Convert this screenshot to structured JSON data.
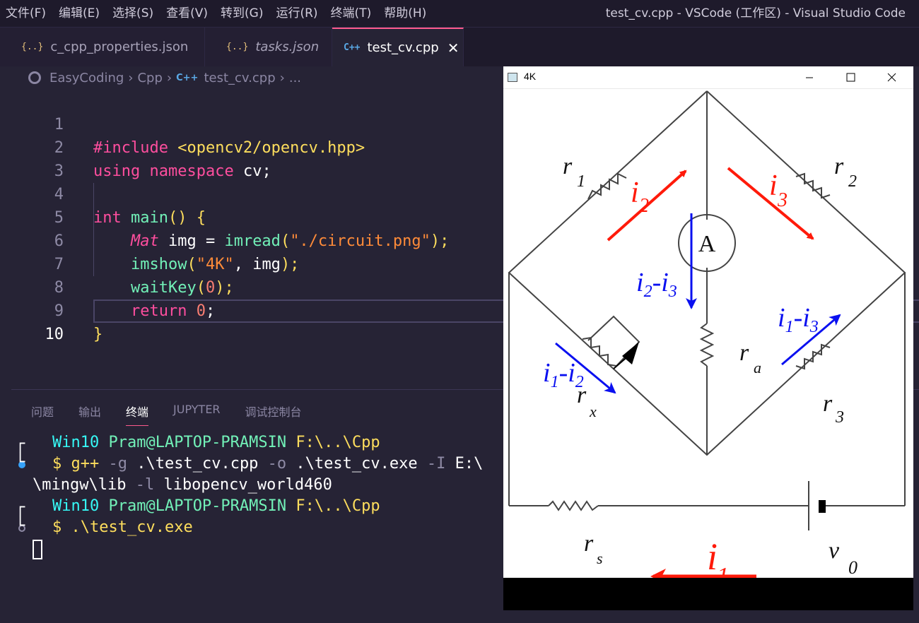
{
  "menu": [
    "文件(F)",
    "编辑(E)",
    "选择(S)",
    "查看(V)",
    "转到(G)",
    "运行(R)",
    "终端(T)",
    "帮助(H)"
  ],
  "window_title": "test_cv.cpp - VSCode (工作区) - Visual Studio Code",
  "tabs": [
    {
      "icon": "{..}",
      "label": "c_cpp_properties.json"
    },
    {
      "icon": "{..}",
      "label": "tasks.json"
    },
    {
      "icon": "C++",
      "label": "test_cv.cpp",
      "close": "✕"
    }
  ],
  "breadcrumb": [
    "EasyCoding",
    "Cpp",
    "test_cv.cpp",
    "..."
  ],
  "breadcrumb_file_icon": "C++",
  "breadcrumb_sep": "›",
  "line_numbers": [
    "1",
    "2",
    "3",
    "4",
    "5",
    "6",
    "7",
    "8",
    "9",
    "10"
  ],
  "code": {
    "l1_include": "#include",
    "l1_header": "<opencv2/opencv.hpp>",
    "l2_using": "using",
    "l2_namespace": "namespace",
    "l2_cv": " cv;",
    "l4_int": "int",
    "l4_main": "main",
    "l4_rest": "() {",
    "l5_mat": "Mat",
    "l5_img": " img = ",
    "l5_imread": "imread",
    "l5_open": "(",
    "l5_str": "\"./circuit.png\"",
    "l5_close": ");",
    "l6_imshow": "imshow",
    "l6_open": "(",
    "l6_str": "\"4K\"",
    "l6_rest": ", img",
    "l6_close": ");",
    "l7_waitkey": "waitKey",
    "l7_open": "(",
    "l7_num": "0",
    "l7_close": ");",
    "l8_return": "return",
    "l8_num": " 0",
    "l8_semi": ";",
    "l9_brace": "}"
  },
  "panel_tabs": [
    "问题",
    "输出",
    "终端",
    "JUPYTER",
    "调试控制台"
  ],
  "terminal": {
    "prompt1_os": "Win10",
    "prompt1_user": "Pram@LAPTOP-PRAMSIN",
    "prompt1_path": "F:\\..\\Cpp",
    "cmd1_dollar": "$ ",
    "cmd1_prog": "g++",
    "cmd1_g": " -g",
    "cmd1_src": " .\\test_cv.cpp",
    "cmd1_o": " -o",
    "cmd1_exe": " .\\test_cv.exe",
    "cmd1_I": " -I",
    "cmd1_e": " E:\\",
    "cmd1_cont": "\\mingw\\lib",
    "cmd1_l": " -l",
    "cmd1_lib": " libopencv_world460",
    "prompt2_os": "Win10",
    "prompt2_user": "Pram@LAPTOP-PRAMSIN",
    "prompt2_path": "F:\\..\\Cpp",
    "cmd2_dollar": "$ ",
    "cmd2_run": ".\\test_cv.exe",
    "bracket_top": "┌",
    "bracket_bot": "└"
  },
  "image_window": {
    "title": "4K",
    "labels": {
      "r1": "r",
      "r1_sub": "1",
      "r2": "r",
      "r2_sub": "2",
      "r3": "r",
      "r3_sub": "3",
      "ra": "r",
      "ra_sub": "a",
      "rx": "r",
      "rx_sub": "x",
      "rs": "r",
      "rs_sub": "s",
      "v0": "v",
      "v0_sub": "0",
      "ammeter": "A",
      "i1": "i",
      "i1_sub": "1",
      "i2": "i",
      "i2_sub": "2",
      "i3": "i",
      "i3_sub": "3",
      "i2_i3_a": "i",
      "i2_i3_a_sub": "2",
      "i2_i3_dash": "-i",
      "i2_i3_b_sub": "3",
      "i1_i3_a": "i",
      "i1_i3_a_sub": "1",
      "i1_i3_dash": "-i",
      "i1_i3_b_sub": "3",
      "i1_i2_a": "i",
      "i1_i2_a_sub": "1",
      "i1_i2_dash": "-i",
      "i1_i2_b_sub": "2"
    }
  },
  "colors": {
    "editor_bg": "#262335",
    "accent": "#fc5a8d",
    "arrow_red": "#ff1a0a",
    "arrow_blue": "#0a10f0"
  }
}
